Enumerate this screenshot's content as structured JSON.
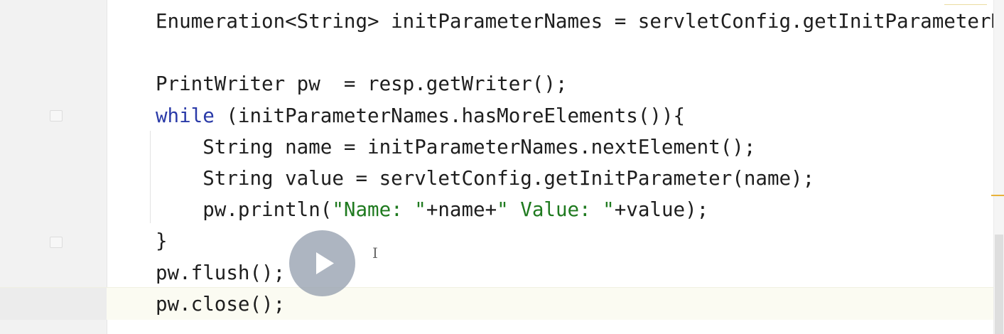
{
  "editor": {
    "lines": [
      {
        "indent": "",
        "parts": [
          {
            "t": "Enumeration<String> initParameterNames = servletConfig.getInitParameterNames();",
            "c": ""
          }
        ]
      },
      {
        "indent": "",
        "parts": [
          {
            "t": "",
            "c": ""
          }
        ]
      },
      {
        "indent": "",
        "parts": [
          {
            "t": "PrintWriter pw  = resp.getWriter();",
            "c": ""
          }
        ]
      },
      {
        "indent": "",
        "parts": [
          {
            "t": "while",
            "c": "kw"
          },
          {
            "t": " (initParameterNames.hasMoreElements()){",
            "c": ""
          }
        ]
      },
      {
        "indent": "    ",
        "parts": [
          {
            "t": "String name = initParameterNames.nextElement();",
            "c": ""
          }
        ]
      },
      {
        "indent": "    ",
        "parts": [
          {
            "t": "String value = servletConfig.getInitParameter(name);",
            "c": ""
          }
        ]
      },
      {
        "indent": "    ",
        "parts": [
          {
            "t": "pw.println(",
            "c": ""
          },
          {
            "t": "\"Name: \"",
            "c": "str"
          },
          {
            "t": "+name+",
            "c": ""
          },
          {
            "t": "\" Value: \"",
            "c": "str"
          },
          {
            "t": "+value);",
            "c": ""
          }
        ]
      },
      {
        "indent": "",
        "parts": [
          {
            "t": "}",
            "c": ""
          }
        ]
      },
      {
        "indent": "",
        "parts": [
          {
            "t": "pw.flush();",
            "c": ""
          }
        ]
      },
      {
        "indent": "",
        "parts": [
          {
            "t": "pw.close();",
            "c": ""
          }
        ]
      }
    ]
  },
  "overlay": {
    "play_icon": "play-icon",
    "cursor_icon": "text-cursor-icon"
  },
  "colors": {
    "keyword": "#2a3aa8",
    "string": "#1f7a1f",
    "text": "#1e1e1e",
    "gutter": "#f2f2f2",
    "current_line": "#fbfbf2"
  }
}
